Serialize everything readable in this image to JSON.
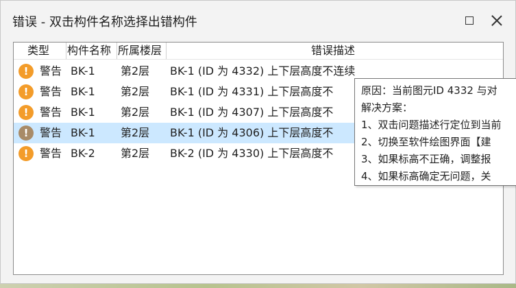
{
  "window": {
    "title": "错误 - 双击构件名称选择出错构件"
  },
  "columns": [
    "类型",
    "构件名称",
    "所属楼层",
    "错误描述"
  ],
  "rows": [
    {
      "type": "警告",
      "name": "BK-1",
      "floor": "第2层",
      "desc": "BK-1 (ID 为 4332) 上下层高度不连续",
      "selected": false
    },
    {
      "type": "警告",
      "name": "BK-1",
      "floor": "第2层",
      "desc": "BK-1 (ID 为 4331) 上下层高度不",
      "selected": false
    },
    {
      "type": "警告",
      "name": "BK-1",
      "floor": "第2层",
      "desc": "BK-1 (ID 为 4307) 上下层高度不",
      "selected": false
    },
    {
      "type": "警告",
      "name": "BK-1",
      "floor": "第2层",
      "desc": "BK-1 (ID 为 4306) 上下层高度不",
      "selected": true
    },
    {
      "type": "警告",
      "name": "BK-2",
      "floor": "第2层",
      "desc": "BK-2 (ID 为 4330) 上下层高度不",
      "selected": false
    }
  ],
  "tooltip": {
    "lines": [
      "原因：当前图元ID 4332 与对",
      "解决方案：",
      "1、双击问题描述行定位到当前",
      "2、切换至软件绘图界面【建",
      "3、如果标高不正确，调整报",
      "4、如果标高确定无问题，关"
    ]
  },
  "icons": {
    "warning": "warning-icon",
    "maximize": "maximize-icon",
    "close": "close-icon"
  },
  "colors": {
    "warning": "#f39c2a",
    "selection": "#cce8ff"
  }
}
